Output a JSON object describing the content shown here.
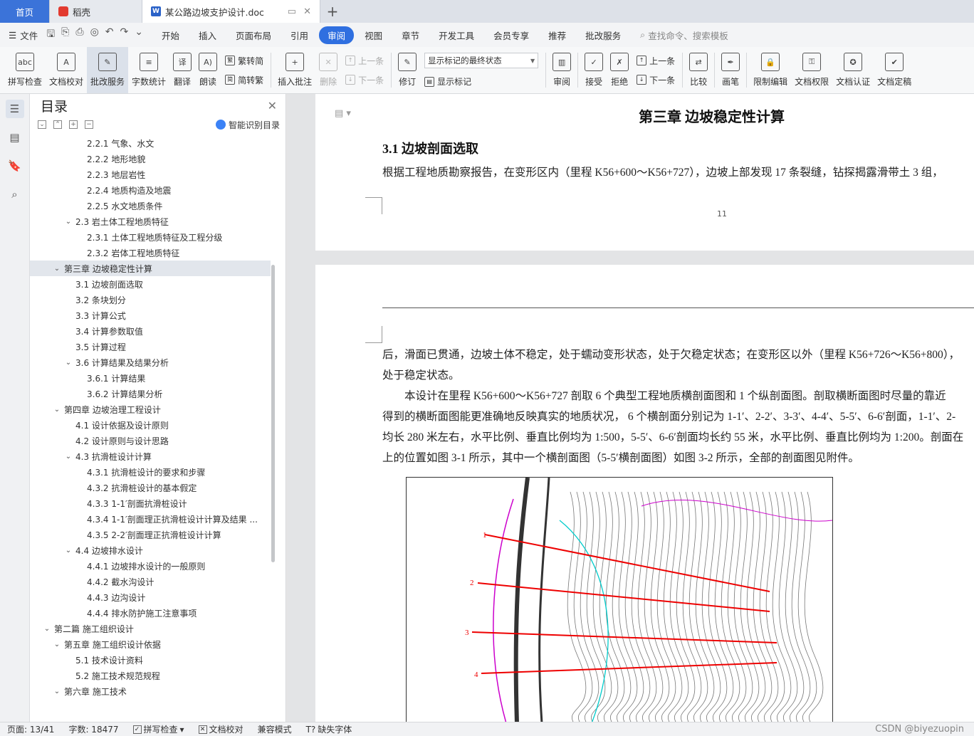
{
  "tabs": {
    "home": "首页",
    "daoke": "稻壳",
    "doc": "某公路边坡支护设计.doc"
  },
  "menubar": {
    "file": "文件",
    "items": [
      "开始",
      "插入",
      "页面布局",
      "引用",
      "审阅",
      "视图",
      "章节",
      "开发工具",
      "会员专享",
      "推荐",
      "批改服务"
    ],
    "active": "审阅",
    "search_placeholder": "查找命令、搜索模板"
  },
  "ribbon": {
    "spell_check": "拼写检查",
    "doc_proof": "文档校对",
    "correct_service": "批改服务",
    "word_count": "字数统计",
    "translate": "翻译",
    "read_aloud": "朗读",
    "trad_to_simp": "繁转简",
    "simp_to_trad": "简转繁",
    "insert_comment": "插入批注",
    "delete": "删除",
    "prev": "上一条",
    "next": "下一条",
    "revise": "修订",
    "display_select": "显示标记的最终状态",
    "show_markup": "显示标记",
    "review": "审阅",
    "accept": "接受",
    "reject": "拒绝",
    "prev2": "上一条",
    "next2": "下一条",
    "compare": "比较",
    "pen": "画笔",
    "restrict_edit": "限制编辑",
    "doc_permission": "文档权限",
    "doc_auth": "文档认证",
    "doc_finalize": "文档定稿"
  },
  "toc": {
    "title": "目录",
    "smart": "智能识别目录",
    "items": [
      {
        "label": "2.2.1 气象、水文",
        "indent": 3,
        "chev": ""
      },
      {
        "label": "2.2.2 地形地貌",
        "indent": 3,
        "chev": ""
      },
      {
        "label": "2.2.3 地层岩性",
        "indent": 3,
        "chev": ""
      },
      {
        "label": "2.2.4 地质构造及地震",
        "indent": 3,
        "chev": ""
      },
      {
        "label": "2.2.5 水文地质条件",
        "indent": 3,
        "chev": ""
      },
      {
        "label": "2.3  岩土体工程地质特征",
        "indent": 2,
        "chev": "v"
      },
      {
        "label": "2.3.1 土体工程地质特征及工程分级",
        "indent": 3,
        "chev": ""
      },
      {
        "label": "2.3.2 岩体工程地质特征",
        "indent": 3,
        "chev": ""
      },
      {
        "label": "第三章   边坡稳定性计算",
        "indent": 1,
        "chev": "v",
        "selected": true
      },
      {
        "label": "3.1  边坡剖面选取",
        "indent": 2,
        "chev": ""
      },
      {
        "label": "3.2  条块划分",
        "indent": 2,
        "chev": ""
      },
      {
        "label": "3.3  计算公式",
        "indent": 2,
        "chev": ""
      },
      {
        "label": "3.4  计算参数取值",
        "indent": 2,
        "chev": ""
      },
      {
        "label": "3.5  计算过程",
        "indent": 2,
        "chev": ""
      },
      {
        "label": "3.6  计算结果及结果分析",
        "indent": 2,
        "chev": "v"
      },
      {
        "label": "3.6.1  计算结果",
        "indent": 3,
        "chev": ""
      },
      {
        "label": "3.6.2  计算结果分析",
        "indent": 3,
        "chev": ""
      },
      {
        "label": "第四章   边坡治理工程设计",
        "indent": 1,
        "chev": "v"
      },
      {
        "label": "4.1 设计依据及设计原则",
        "indent": 2,
        "chev": ""
      },
      {
        "label": "4.2  设计原则与设计思路",
        "indent": 2,
        "chev": ""
      },
      {
        "label": "4.3  抗滑桩设计计算",
        "indent": 2,
        "chev": "v"
      },
      {
        "label": "4.3.1 抗滑桩设计的要求和步骤",
        "indent": 3,
        "chev": ""
      },
      {
        "label": "4.3.2 抗滑桩设计的基本假定",
        "indent": 3,
        "chev": ""
      },
      {
        "label": "4.3.3 1-1′剖面抗滑桩设计",
        "indent": 3,
        "chev": ""
      },
      {
        "label": "4.3.4    1-1′剖面理正抗滑桩设计计算及结果 ...",
        "indent": 3,
        "chev": ""
      },
      {
        "label": "4.3.5 2-2′剖面理正抗滑桩设计计算",
        "indent": 3,
        "chev": ""
      },
      {
        "label": "4.4  边坡排水设计",
        "indent": 2,
        "chev": "v"
      },
      {
        "label": "4.4.1 边坡排水设计的一般原则",
        "indent": 3,
        "chev": ""
      },
      {
        "label": "4.4.2 截水沟设计",
        "indent": 3,
        "chev": ""
      },
      {
        "label": "4.4.3 边沟设计",
        "indent": 3,
        "chev": ""
      },
      {
        "label": "4.4.4 排水防护施工注意事项",
        "indent": 3,
        "chev": ""
      },
      {
        "label": "第二篇  施工组织设计",
        "indent": 0,
        "chev": "v"
      },
      {
        "label": "第五章    施工组织设计依据",
        "indent": 1,
        "chev": "v"
      },
      {
        "label": "5.1  技术设计资料",
        "indent": 2,
        "chev": ""
      },
      {
        "label": "5.2  施工技术规范规程",
        "indent": 2,
        "chev": ""
      },
      {
        "label": "第六章    施工技术",
        "indent": 1,
        "chev": "v"
      }
    ]
  },
  "document": {
    "chapter_title": "第三章    边坡稳定性计算",
    "section_title": "3.1  边坡剖面选取",
    "para1": "根据工程地质勘察报告，在变形区内（里程 K56+600～K56+727），边坡上部发现 17 条裂缝，钻探揭露滑带土 3 组，",
    "page_number": "11",
    "lines": [
      "后，滑面已贯通，边坡土体不稳定，处于蠕动变形状态，处于欠稳定状态；在变形区以外（里程 K56+726～K56+800），",
      "处于稳定状态。",
      "本设计在里程 K56+600～K56+727 剖取 6 个典型工程地质横剖面图和 1 个纵剖面图。剖取横断面图时尽量的靠近",
      "得到的横断面图能更准确地反映真实的地质状况，  6 个横剖面分别记为 1-1′、2-2′、3-3′、4-4′、5-5′、6-6′剖面，1-1′、2-",
      "均长 280 米左右，水平比例、垂直比例均为 1:500，5-5′、6-6′剖面均长约 55 米，水平比例、垂直比例均为 1:200。剖面在",
      "上的位置如图 3-1 所示，其中一个横剖面图（5-5′横剖面图）如图 3-2 所示，全部的剖面图见附件。"
    ],
    "figure_labels": [
      "1",
      "2",
      "3",
      "4"
    ]
  },
  "status": {
    "page": "页面: 13/41",
    "words": "字数: 18477",
    "spell": "拼写检查",
    "proof": "文档校对",
    "compat": "兼容模式",
    "missing_font": "缺失字体",
    "watermark": "CSDN @biyezuopin"
  }
}
